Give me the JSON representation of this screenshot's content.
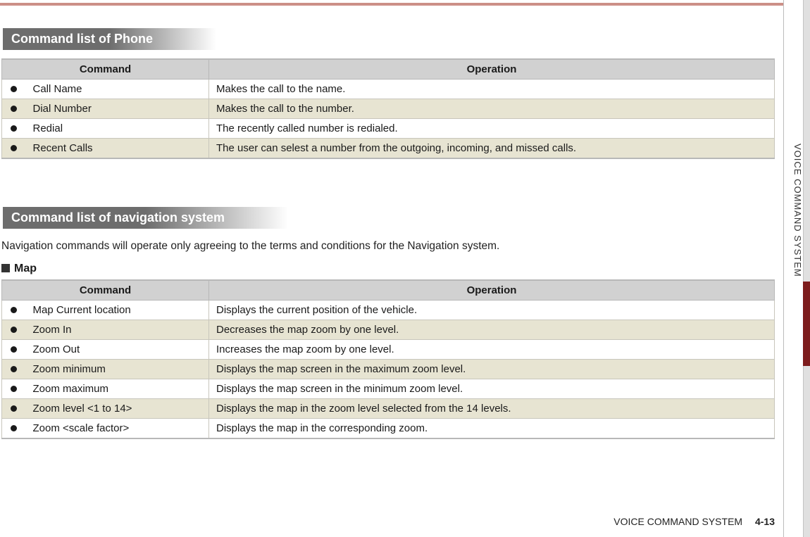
{
  "side_tab": "VOICE COMMAND SYSTEM",
  "footer_label": "VOICE COMMAND SYSTEM",
  "footer_page": "4-13",
  "section_phone": {
    "title": "Command list of Phone",
    "headers": {
      "command": "Command",
      "operation": "Operation"
    },
    "rows": [
      {
        "command": "Call Name",
        "operation": "Makes the call to the name."
      },
      {
        "command": "Dial Number",
        "operation": "Makes the call to the number."
      },
      {
        "command": "Redial",
        "operation": "The recently called number is redialed."
      },
      {
        "command": "Recent Calls",
        "operation": "The user can selest a number from the outgoing, incoming, and missed calls."
      }
    ]
  },
  "section_nav": {
    "title": "Command list of navigation system",
    "note": "Navigation commands will operate only agreeing to the terms and  conditions for the Navigation system.",
    "sub_heading": "Map",
    "headers": {
      "command": "Command",
      "operation": "Operation"
    },
    "rows": [
      {
        "command": "Map Current location",
        "operation": "Displays the current position of the vehicle."
      },
      {
        "command": "Zoom In",
        "operation": "Decreases the map zoom by one level."
      },
      {
        "command": "Zoom Out",
        "operation": "Increases the map zoom by one level."
      },
      {
        "command": "Zoom minimum",
        "operation": "Displays the map screen in the maximum zoom level."
      },
      {
        "command": "Zoom maximum",
        "operation": "Displays the map screen in the minimum zoom level."
      },
      {
        "command": "Zoom level <1 to 14>",
        "operation": "Displays the map in the zoom level selected from the 14 levels."
      },
      {
        "command": "Zoom <scale factor>",
        "operation": "Displays the map in the corresponding zoom."
      }
    ]
  }
}
